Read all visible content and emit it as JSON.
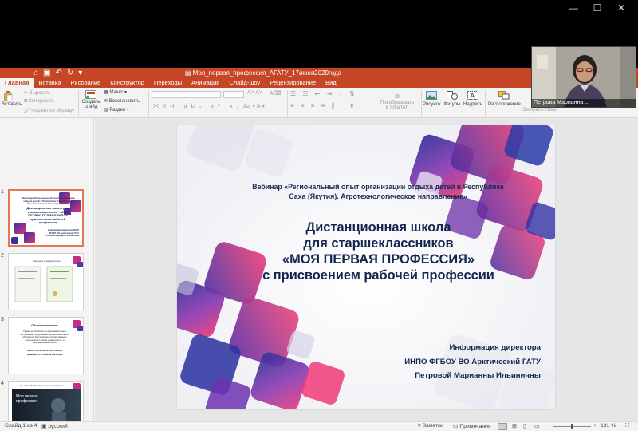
{
  "window": {
    "title": "Моя_первая_профессия_АГАТУ_17июня2020года",
    "controls": [
      "—",
      "☐",
      "✕"
    ]
  },
  "ribbon_tabs": [
    "Главная",
    "Вставка",
    "Рисование",
    "Конструктор",
    "Переходы",
    "Анимация",
    "Слайд-шоу",
    "Рецензирование",
    "Вид"
  ],
  "active_tab": "Главная",
  "ribbon": {
    "paste": "Вставить",
    "cut": "Вырезать",
    "copy": "Копировать",
    "format_painter": "Формат по образцу",
    "new_slide_1": "Создать",
    "new_slide_2": "слайд",
    "layout": "Макет",
    "reset": "Восстановить",
    "section": "Раздел",
    "smartart_1": "Преобразовать",
    "smartart_2": "в SmartArt",
    "picture": "Рисунок",
    "shapes": "Фигуры",
    "textbox": "Надпись",
    "arrange": "Расположение",
    "quick_styles": "Экспресс-стили"
  },
  "thumbnails": [
    {
      "num": "1",
      "selected": true
    },
    {
      "num": "2",
      "selected": false
    },
    {
      "num": "3",
      "selected": false
    },
    {
      "num": "4",
      "selected": false
    }
  ],
  "thumb_text": {
    "t1_a": "Вебинар «Региональный опыт организации отдыха детей в Республике Саха (Якутия). Агротехнологическое направление»",
    "t1_b": "Дистанционная школа для старшеклассников «МОЯ ПЕРВАЯ ПРОФЕССИЯ» с присвоением рабочей профессии",
    "t1_c": "Информация директора ИНПО ФГБОУ ВО Арктический ГАТУ Петровой Марианны Ильиничны",
    "t2_title": "Лицензия и аккредитация",
    "t3_title": "Общее положение:",
    "t3_body": "Прием на обучение по образовательным программам - программам профессионального обучения в Арктическом государственном агротехнологическом университете, в Дистанционной школе",
    "t3_name": "«МОЯ ПЕРВАЯ ПРОФЕССИЯ»",
    "t3_date": "начинается с 23 июня 2020 года",
    "t4_top": "На сайте АГАТУ «Моя первая профессия»",
    "t4_a": "Моя первая",
    "t4_b": "профессия"
  },
  "slide": {
    "webinar_1": "Вебинар «Региональный опыт организации отдыха детей в Республике",
    "webinar_2": "Саха (Якутия). Агротехнологическое направление»",
    "title_1": "Дистанционная школа",
    "title_2": "для старшеклассников",
    "title_3": "«МОЯ ПЕРВАЯ ПРОФЕССИЯ»",
    "title_4": "с присвоением рабочей профессии",
    "info_1": "Информация директора",
    "info_2": "ИНПО ФГБОУ ВО Арктический ГАТУ",
    "info_3": "Петровой Марианны Ильиничны"
  },
  "status": {
    "slide_counter": "Слайд 1 из 4",
    "language": "русский",
    "notes": "Заметки",
    "comments": "Примечания",
    "zoom": "131 %"
  },
  "video": {
    "participant": "Петрова Марианна ..."
  },
  "colors": {
    "accent": "#c64524",
    "slide_text": "#14264f",
    "selection": "#e0794f"
  }
}
